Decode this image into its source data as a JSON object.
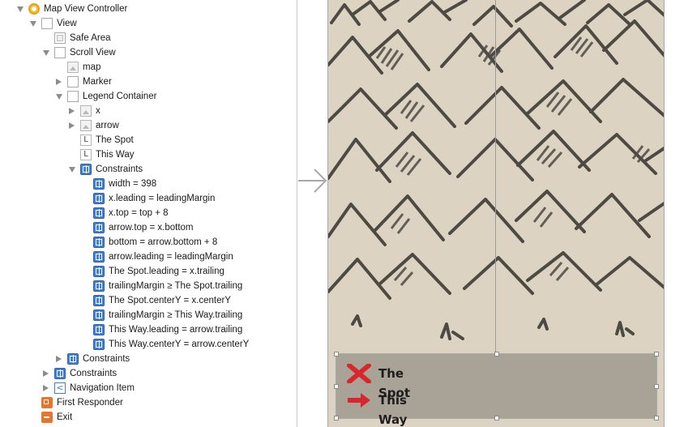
{
  "outline": {
    "items": [
      {
        "label": "Map View Controller",
        "icon": "view-controller-icon",
        "indent": 0,
        "disclosure": "open"
      },
      {
        "label": "View",
        "icon": "view-icon",
        "indent": 1,
        "disclosure": "open"
      },
      {
        "label": "Safe Area",
        "icon": "safe-area-icon",
        "indent": 2,
        "disclosure": "none"
      },
      {
        "label": "Scroll View",
        "icon": "view-icon",
        "indent": 2,
        "disclosure": "open"
      },
      {
        "label": "map",
        "icon": "image-icon",
        "indent": 3,
        "disclosure": "none"
      },
      {
        "label": "Marker",
        "icon": "view-icon",
        "indent": 3,
        "disclosure": "closed"
      },
      {
        "label": "Legend Container",
        "icon": "view-icon",
        "indent": 3,
        "disclosure": "open"
      },
      {
        "label": "x",
        "icon": "image-icon",
        "indent": 4,
        "disclosure": "closed"
      },
      {
        "label": "arrow",
        "icon": "image-icon",
        "indent": 4,
        "disclosure": "closed"
      },
      {
        "label": "The Spot",
        "icon": "label-icon",
        "indent": 4,
        "disclosure": "none"
      },
      {
        "label": "This Way",
        "icon": "label-icon",
        "indent": 4,
        "disclosure": "none"
      },
      {
        "label": "Constraints",
        "icon": "constraints-icon",
        "indent": 4,
        "disclosure": "open"
      },
      {
        "label": "width = 398",
        "icon": "constraint-icon",
        "indent": 5,
        "disclosure": "none"
      },
      {
        "label": "x.leading = leadingMargin",
        "icon": "constraint-icon",
        "indent": 5,
        "disclosure": "none"
      },
      {
        "label": "x.top = top + 8",
        "icon": "constraint-icon",
        "indent": 5,
        "disclosure": "none"
      },
      {
        "label": "arrow.top = x.bottom",
        "icon": "constraint-icon",
        "indent": 5,
        "disclosure": "none"
      },
      {
        "label": "bottom = arrow.bottom + 8",
        "icon": "constraint-icon",
        "indent": 5,
        "disclosure": "none"
      },
      {
        "label": "arrow.leading = leadingMargin",
        "icon": "constraint-icon",
        "indent": 5,
        "disclosure": "none"
      },
      {
        "label": "The Spot.leading = x.trailing",
        "icon": "constraint-icon",
        "indent": 5,
        "disclosure": "none"
      },
      {
        "label": "trailingMargin ≥ The Spot.trailing",
        "icon": "constraint-icon",
        "indent": 5,
        "disclosure": "none"
      },
      {
        "label": "The Spot.centerY = x.centerY",
        "icon": "constraint-icon",
        "indent": 5,
        "disclosure": "none"
      },
      {
        "label": "trailingMargin ≥ This Way.trailing",
        "icon": "constraint-icon",
        "indent": 5,
        "disclosure": "none"
      },
      {
        "label": "This Way.leading = arrow.trailing",
        "icon": "constraint-icon",
        "indent": 5,
        "disclosure": "none"
      },
      {
        "label": "This Way.centerY = arrow.centerY",
        "icon": "constraint-icon",
        "indent": 5,
        "disclosure": "none"
      },
      {
        "label": "Constraints",
        "icon": "constraints-icon",
        "indent": 3,
        "disclosure": "closed"
      },
      {
        "label": "Constraints",
        "icon": "constraints-icon",
        "indent": 2,
        "disclosure": "closed"
      },
      {
        "label": "Navigation Item",
        "icon": "navigation-item-icon",
        "indent": 2,
        "disclosure": "closed"
      },
      {
        "label": "First Responder",
        "icon": "first-responder-icon",
        "indent": 1,
        "disclosure": "none"
      },
      {
        "label": "Exit",
        "icon": "exit-icon",
        "indent": 1,
        "disclosure": "none"
      }
    ]
  },
  "canvas": {
    "entry_arrow_icon": "entry-point-arrow-icon",
    "legend": {
      "items": [
        {
          "label": "The Spot",
          "icon": "x-mark-icon",
          "color": "#d9262c"
        },
        {
          "label": "This Way",
          "icon": "arrow-right-icon",
          "color": "#d9262c"
        }
      ],
      "background": "#a9a397"
    },
    "map_background": "#dcd3c3",
    "sketch_color": "#4d4a44"
  }
}
